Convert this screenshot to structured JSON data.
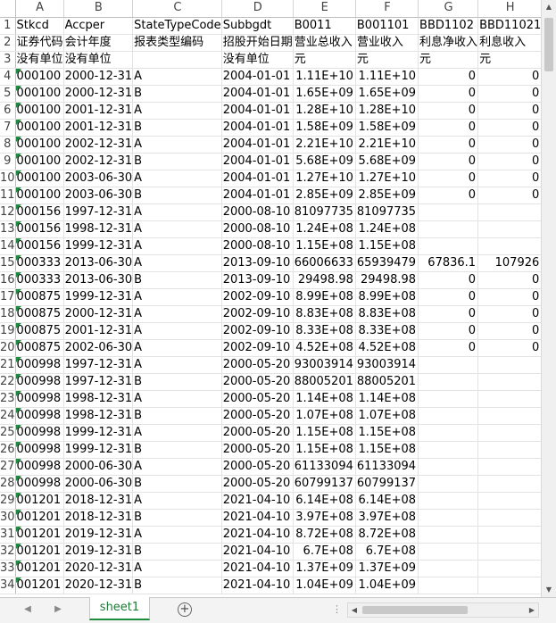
{
  "sheet": {
    "columns": [
      "A",
      "B",
      "C",
      "D",
      "E",
      "F",
      "G",
      "H"
    ],
    "rows": [
      {
        "n": "1",
        "cells": [
          "Stkcd",
          "Accper",
          "StateTypeCode",
          "Subbgdt",
          "B0011",
          "B001101",
          "BBD1102",
          "BBD11021"
        ]
      },
      {
        "n": "2",
        "cells": [
          "证券代码",
          "会计年度",
          "报表类型编码",
          "招股开始日期",
          "营业总收入",
          "营业收入",
          "利息净收入",
          "利息收入"
        ]
      },
      {
        "n": "3",
        "cells": [
          "没有单位",
          "没有单位",
          "",
          "没有单位",
          "元",
          "元",
          "元",
          "元"
        ]
      },
      {
        "n": "4",
        "cells": [
          "000100",
          "2000-12-31",
          "A",
          "2004-01-01",
          "1.11E+10",
          "1.11E+10",
          "0",
          "0"
        ]
      },
      {
        "n": "5",
        "cells": [
          "000100",
          "2000-12-31",
          "B",
          "2004-01-01",
          "1.65E+09",
          "1.65E+09",
          "0",
          "0"
        ]
      },
      {
        "n": "6",
        "cells": [
          "000100",
          "2001-12-31",
          "A",
          "2004-01-01",
          "1.28E+10",
          "1.28E+10",
          "0",
          "0"
        ]
      },
      {
        "n": "7",
        "cells": [
          "000100",
          "2001-12-31",
          "B",
          "2004-01-01",
          "1.58E+09",
          "1.58E+09",
          "0",
          "0"
        ]
      },
      {
        "n": "8",
        "cells": [
          "000100",
          "2002-12-31",
          "A",
          "2004-01-01",
          "2.21E+10",
          "2.21E+10",
          "0",
          "0"
        ]
      },
      {
        "n": "9",
        "cells": [
          "000100",
          "2002-12-31",
          "B",
          "2004-01-01",
          "5.68E+09",
          "5.68E+09",
          "0",
          "0"
        ]
      },
      {
        "n": "10",
        "cells": [
          "000100",
          "2003-06-30",
          "A",
          "2004-01-01",
          "1.27E+10",
          "1.27E+10",
          "0",
          "0"
        ]
      },
      {
        "n": "11",
        "cells": [
          "000100",
          "2003-06-30",
          "B",
          "2004-01-01",
          "2.85E+09",
          "2.85E+09",
          "0",
          "0"
        ]
      },
      {
        "n": "12",
        "cells": [
          "000156",
          "1997-12-31",
          "A",
          "2000-08-10",
          "81097735",
          "81097735",
          "",
          ""
        ]
      },
      {
        "n": "13",
        "cells": [
          "000156",
          "1998-12-31",
          "A",
          "2000-08-10",
          "1.24E+08",
          "1.24E+08",
          "",
          ""
        ]
      },
      {
        "n": "14",
        "cells": [
          "000156",
          "1999-12-31",
          "A",
          "2000-08-10",
          "1.15E+08",
          "1.15E+08",
          "",
          ""
        ]
      },
      {
        "n": "15",
        "cells": [
          "000333",
          "2013-06-30",
          "A",
          "2013-09-10",
          "66006633",
          "65939479",
          "67836.1",
          "107926"
        ]
      },
      {
        "n": "16",
        "cells": [
          "000333",
          "2013-06-30",
          "B",
          "2013-09-10",
          "29498.98",
          "29498.98",
          "0",
          "0"
        ]
      },
      {
        "n": "17",
        "cells": [
          "000875",
          "1999-12-31",
          "A",
          "2002-09-10",
          "8.99E+08",
          "8.99E+08",
          "0",
          "0"
        ]
      },
      {
        "n": "18",
        "cells": [
          "000875",
          "2000-12-31",
          "A",
          "2002-09-10",
          "8.83E+08",
          "8.83E+08",
          "0",
          "0"
        ]
      },
      {
        "n": "19",
        "cells": [
          "000875",
          "2001-12-31",
          "A",
          "2002-09-10",
          "8.33E+08",
          "8.33E+08",
          "0",
          "0"
        ]
      },
      {
        "n": "20",
        "cells": [
          "000875",
          "2002-06-30",
          "A",
          "2002-09-10",
          "4.52E+08",
          "4.52E+08",
          "0",
          "0"
        ]
      },
      {
        "n": "21",
        "cells": [
          "000998",
          "1997-12-31",
          "A",
          "2000-05-20",
          "93003914",
          "93003914",
          "",
          ""
        ]
      },
      {
        "n": "22",
        "cells": [
          "000998",
          "1997-12-31",
          "B",
          "2000-05-20",
          "88005201",
          "88005201",
          "",
          ""
        ]
      },
      {
        "n": "23",
        "cells": [
          "000998",
          "1998-12-31",
          "A",
          "2000-05-20",
          "1.14E+08",
          "1.14E+08",
          "",
          ""
        ]
      },
      {
        "n": "24",
        "cells": [
          "000998",
          "1998-12-31",
          "B",
          "2000-05-20",
          "1.07E+08",
          "1.07E+08",
          "",
          ""
        ]
      },
      {
        "n": "25",
        "cells": [
          "000998",
          "1999-12-31",
          "A",
          "2000-05-20",
          "1.15E+08",
          "1.15E+08",
          "",
          ""
        ]
      },
      {
        "n": "26",
        "cells": [
          "000998",
          "1999-12-31",
          "B",
          "2000-05-20",
          "1.15E+08",
          "1.15E+08",
          "",
          ""
        ]
      },
      {
        "n": "27",
        "cells": [
          "000998",
          "2000-06-30",
          "A",
          "2000-05-20",
          "61133094",
          "61133094",
          "",
          ""
        ]
      },
      {
        "n": "28",
        "cells": [
          "000998",
          "2000-06-30",
          "B",
          "2000-05-20",
          "60799137",
          "60799137",
          "",
          ""
        ]
      },
      {
        "n": "29",
        "cells": [
          "001201",
          "2018-12-31",
          "A",
          "2021-04-10",
          "6.14E+08",
          "6.14E+08",
          "",
          ""
        ]
      },
      {
        "n": "30",
        "cells": [
          "001201",
          "2018-12-31",
          "B",
          "2021-04-10",
          "3.97E+08",
          "3.97E+08",
          "",
          ""
        ]
      },
      {
        "n": "31",
        "cells": [
          "001201",
          "2019-12-31",
          "A",
          "2021-04-10",
          "8.72E+08",
          "8.72E+08",
          "",
          ""
        ]
      },
      {
        "n": "32",
        "cells": [
          "001201",
          "2019-12-31",
          "B",
          "2021-04-10",
          "6.7E+08",
          "6.7E+08",
          "",
          ""
        ]
      },
      {
        "n": "33",
        "cells": [
          "001201",
          "2020-12-31",
          "A",
          "2021-04-10",
          "1.37E+09",
          "1.37E+09",
          "",
          ""
        ]
      },
      {
        "n": "34",
        "cells": [
          "001201",
          "2020-12-31",
          "B",
          "2021-04-10",
          "1.04E+09",
          "1.04E+09",
          "",
          ""
        ]
      }
    ]
  },
  "tabs": {
    "active_sheet": "sheet1",
    "add_label": "+"
  },
  "icons": {
    "nav_prev": "◀",
    "nav_next": "▶",
    "scroll_up": "▲",
    "scroll_down": "▼",
    "scroll_left": "◀",
    "scroll_right": "▶",
    "separator": "⋮"
  },
  "colors": {
    "accent": "#1e8c3e",
    "tab_text": "#1e7a36"
  }
}
